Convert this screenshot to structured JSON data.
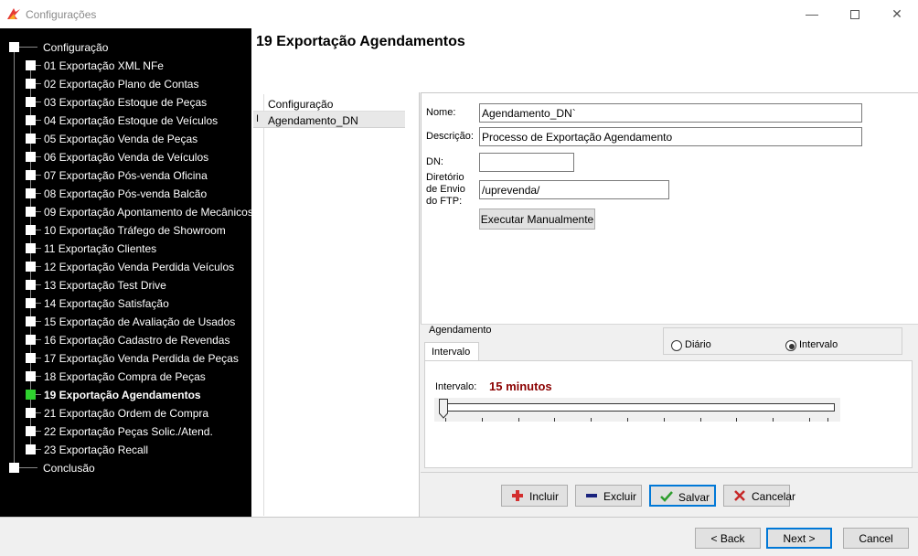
{
  "window": {
    "title": "Configurações",
    "minimize": "—",
    "close": "✕"
  },
  "nav": {
    "root": "Configuração",
    "items": [
      "01 Exportação XML NFe",
      "02 Exportação Plano de Contas",
      "03 Exportação Estoque de Peças",
      "04 Exportação Estoque de Veículos",
      "05 Exportação Venda de Peças",
      "06 Exportação Venda de Veículos",
      "07 Exportação Pós-venda Oficina",
      "08 Exportação Pós-venda Balcão",
      "09 Exportação Apontamento de Mecânicos",
      "10 Exportação Tráfego de Showroom",
      "11 Exportação Clientes",
      "12 Exportação Venda Perdida Veículos",
      "13 Exportação Test Drive",
      "14 Exportação Satisfação",
      "15 Exportação de Avaliação de Usados",
      "16 Exportação Cadastro de Revendas",
      "17 Exportação Venda Perdida de Peças",
      "18 Exportação Compra de Peças",
      "19 Exportação Agendamentos",
      "21 Exportação Ordem de Compra",
      "22 Exportação Peças Solic./Atend.",
      "23 Exportação Recall"
    ],
    "active_index": 18,
    "end": "Conclusão"
  },
  "header": {
    "title": "19 Exportação Agendamentos"
  },
  "list": {
    "header": "Configuração",
    "row": "Agendamento_DN",
    "cursor": "I"
  },
  "form": {
    "nome_label": "Nome:",
    "nome_value": "Agendamento_DN`",
    "descricao_label": "Descrição:",
    "descricao_value": "Processo de Exportação Agendamento",
    "dn_label": "DN:",
    "dn_value": "",
    "diretorio_label_1": "Diretório",
    "diretorio_label_2": "de Envio",
    "diretorio_label_3": "do FTP:",
    "diretorio_value": "/uprevenda/",
    "executar": "Executar Manualmente"
  },
  "agendamento": {
    "section_label": "Agendamento",
    "tab": "Intervalo",
    "radio_diario": "Diário",
    "radio_intervalo": "Intervalo",
    "selected": "Intervalo",
    "intervalo_label": "Intervalo:",
    "intervalo_value": "15 minutos",
    "slider_position": 0.0,
    "tick_count": 22
  },
  "actions": {
    "incluir": "Incluir",
    "excluir": "Excluir",
    "salvar": "Salvar",
    "cancelar": "Cancelar"
  },
  "wizard": {
    "back": "< Back",
    "next": "Next >",
    "cancel": "Cancel"
  },
  "colors": {
    "active_node": "#2fd12f",
    "interval_value": "#8b0000",
    "incluir_icon": "#d32f2f",
    "excluir_icon": "#1a237e",
    "salvar_icon": "#2e9d2e",
    "cancelar_icon": "#c62828"
  }
}
